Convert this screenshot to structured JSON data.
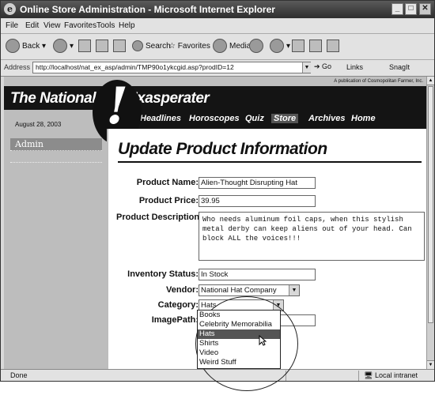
{
  "window": {
    "title": "Online Store Administration - Microsoft Internet Explorer"
  },
  "menu": [
    "File",
    "Edit",
    "View",
    "Favorites",
    "Tools",
    "Help"
  ],
  "toolbar": {
    "back": "Back",
    "search": "Search",
    "favorites": "Favorites",
    "media": "Media"
  },
  "address": {
    "label": "Address",
    "url": "http://localhost/nat_ex_asp/admin/TMP90o1ykcgid.asp?prodID=12",
    "go": "Go",
    "links": "Links",
    "snagit": "SnagIt"
  },
  "site": {
    "publication": "A publication of Cosmopolitan Farmer, Inc.",
    "title_left": "The National",
    "title_right": "Exasperater",
    "date": "August 28, 2003",
    "sidebar_admin": "Admin",
    "nav": [
      "Headlines",
      "Horoscopes",
      "Quiz",
      "Store",
      "Archives",
      "Home"
    ],
    "nav_active": "Store"
  },
  "form": {
    "heading": "Update Product Information",
    "product_name_label": "Product Name:",
    "product_name_value": "Alien-Thought Disrupting Hat",
    "product_price_label": "Product Price:",
    "product_price_value": "39.95",
    "product_description_label": "Product Description:",
    "product_description_value": "Who needs aluminum foil caps, when this stylish metal derby can keep aliens out of your head. Can block ALL the voices!!!",
    "inventory_label": "Inventory Status:",
    "inventory_value": "In Stock",
    "vendor_label": "Vendor:",
    "vendor_value": "National Hat Company",
    "category_label": "Category:",
    "category_value": "Hats",
    "imagepath_label": "ImagePath:",
    "category_options": [
      "Books",
      "Celebrity Memorabilia",
      "Hats",
      "Shirts",
      "Video",
      "Weird Stuff"
    ],
    "category_selected_index": 2
  },
  "status": {
    "left": "Done",
    "zone": "Local intranet"
  }
}
